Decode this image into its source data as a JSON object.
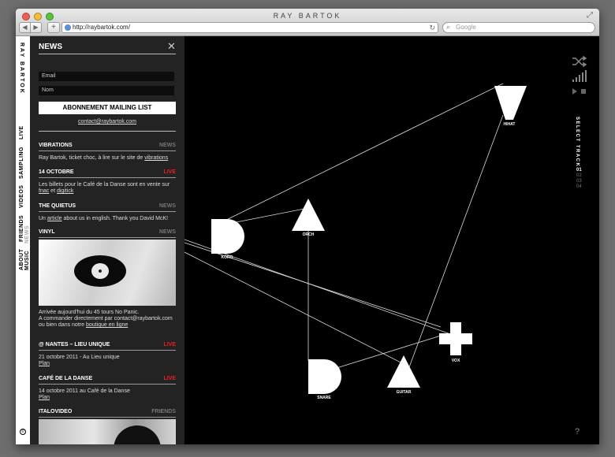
{
  "window": {
    "title": "RAY BARTOK",
    "url": "http://raybartok.com/",
    "search_placeholder": "Google",
    "back_glyph": "◀",
    "forward_glyph": "▶",
    "new_tab_glyph": "+",
    "reload_glyph": "↻",
    "search_glyph": "🔍",
    "resize_glyph": "⤢"
  },
  "sidenav": {
    "logo": "RAY BARTOK",
    "items": [
      "NEWS",
      "MUSIC",
      "LIVE",
      "SAMPLING",
      "VIDEOS",
      "FRIENDS",
      "ABOUT"
    ],
    "active": "NEWS",
    "bottom_icon": "©"
  },
  "panel": {
    "title": "NEWS",
    "close_glyph": "✕",
    "email_placeholder": "Email",
    "name_placeholder": "Nom",
    "subscribe_label": "ABONNEMENT MAILING LIST",
    "contact": "contact@raybartok.com",
    "items": [
      {
        "title": "VIBRATIONS",
        "tag": "NEWS",
        "body_pre": "Ray Bartok, ticket choc, à lire sur le site de ",
        "link": "vibrations",
        "body_post": ""
      },
      {
        "title": "14 OCTOBRE",
        "tag": "LIVE",
        "body_pre": "Les billets pour le Café de la Danse sont en vente sur ",
        "link": "fnac",
        "mid": " et ",
        "link2": "digitick"
      },
      {
        "title": "THE QUIETUS",
        "tag": "NEWS",
        "body_pre": "Un ",
        "link": "article",
        "body_post": " about us in english. Thank you David McK!"
      },
      {
        "title": "VINYL",
        "tag": "NEWS",
        "line1": "Arrivée aujourd'hui du 45 tours No Panic.",
        "line2": "A commander directement par contact@raybartok.com",
        "line3_pre": "ou bien dans notre ",
        "link": "boutique en ligne"
      },
      {
        "title": "@ NANTES – LIEU UNIQUE",
        "tag": "LIVE",
        "line1": "21 octobre 2011  -  Au Lieu unique",
        "link": "Plan"
      },
      {
        "title": "CAFÉ DE LA DANSE",
        "tag": "LIVE",
        "line1": "14 octobre 2011 au Café de la Danse",
        "link": "Plan"
      },
      {
        "title": "ITALOVIDEO",
        "tag": "FRIENDS"
      }
    ]
  },
  "player": {
    "select_track": "SELECT TRACK",
    "tracks": [
      "01",
      "02",
      "03",
      "04"
    ],
    "active_track": "01",
    "help": "?",
    "shuffle_icon": "shuffle-icon",
    "volume_icon": "volume-bars-icon",
    "play_icon": "play-icon",
    "stop_icon": "stop-icon"
  },
  "instruments": [
    "KORG",
    "ORCH",
    "HIHAT",
    "VOX",
    "SNARE",
    "GUITAR"
  ],
  "colors": {
    "accent_live": "#e82020",
    "panel_bg": "#232323",
    "stage_bg": "#000000"
  }
}
